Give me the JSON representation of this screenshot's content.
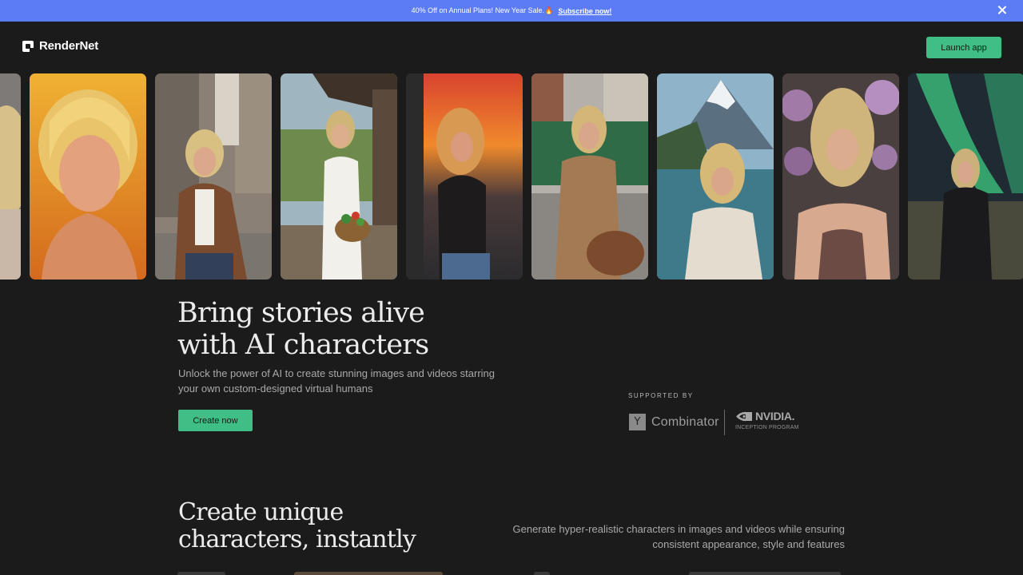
{
  "promo": {
    "text": "40% Off on Annual Plans! New Year Sale.🔥",
    "link": "Subscribe now!"
  },
  "header": {
    "logo_text": "RenderNet",
    "launch_label": "Launch app"
  },
  "gallery": {
    "cards": [
      {
        "name": "portrait-partial",
        "bg": "#6b6b6b"
      },
      {
        "name": "portrait-golden",
        "bg": "#e0a12f"
      },
      {
        "name": "street-leather-jacket",
        "bg": "#8b847c"
      },
      {
        "name": "porch-vegetable-basket",
        "bg": "#6d7a52"
      },
      {
        "name": "sunset-balcony",
        "bg": "#c4523a"
      },
      {
        "name": "tram-trench-coat",
        "bg": "#9d9a94"
      },
      {
        "name": "mountain-lake",
        "bg": "#5e8ea6"
      },
      {
        "name": "flower-wall",
        "bg": "#7f5d7a"
      },
      {
        "name": "aurora-night",
        "bg": "#2a6e55"
      }
    ]
  },
  "hero": {
    "title_line1": "Bring stories alive",
    "title_line2": "with AI characters",
    "subtitle_line1": "Unlock the power of AI to create stunning images and videos starring",
    "subtitle_line2": "your own custom-designed virtual humans",
    "cta_label": "Create now"
  },
  "supporters": {
    "heading": "SUPPORTED BY",
    "yc_mark": "Y",
    "yc_name": "Combinator",
    "nvidia_name": "NVIDIA.",
    "nvidia_program": "INCEPTION PROGRAM"
  },
  "section": {
    "title_line1": "Create unique",
    "title_line2": "characters, instantly",
    "desc_line1": "Generate hyper-realistic characters in images and videos while ensuring",
    "desc_line2": "consistent appearance, style and features"
  },
  "colors": {
    "accent": "#3fbf85",
    "promo_bg": "#5b7cf5",
    "page_bg": "#1b1b1b"
  }
}
